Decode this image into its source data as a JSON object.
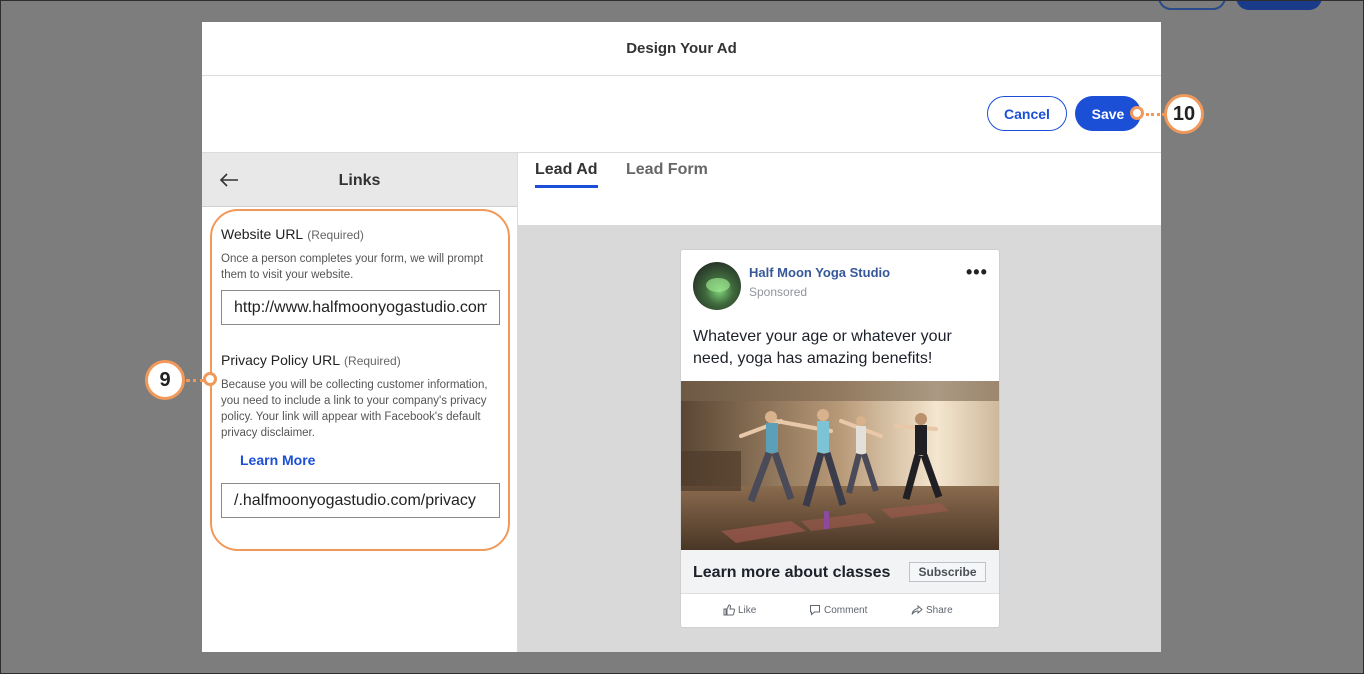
{
  "modal": {
    "title": "Design Your Ad",
    "cancel_label": "Cancel",
    "save_label": "Save"
  },
  "links_panel": {
    "back_icon": "back-arrow-icon",
    "title": "Links",
    "website": {
      "label": "Website URL",
      "required": "(Required)",
      "help": "Once a person completes your form, we will prompt them to visit your website.",
      "value": "http://www.halfmoonyogastudio.com"
    },
    "privacy": {
      "label": "Privacy Policy URL",
      "required": "(Required)",
      "help": "Because you will be collecting customer information, you need to include a link to your company's privacy policy. Your link will appear with Facebook's default privacy disclaimer.",
      "learn_more": "Learn More",
      "value": "/.halfmoonyogastudio.com/privacy"
    }
  },
  "tabs": [
    {
      "label": "Lead Ad",
      "active": true
    },
    {
      "label": "Lead Form",
      "active": false
    }
  ],
  "ad_preview": {
    "page_name": "Half Moon Yoga Studio",
    "sponsored": "Sponsored",
    "body_text": "Whatever your age or whatever your need, yoga has amazing benefits!",
    "cta_text": "Learn more about classes",
    "cta_button": "Subscribe",
    "actions": [
      {
        "label": "Like",
        "icon": "thumbs-up-icon"
      },
      {
        "label": "Comment",
        "icon": "comment-icon"
      },
      {
        "label": "Share",
        "icon": "share-icon"
      }
    ]
  },
  "callouts": {
    "step_9": "9",
    "step_10": "10"
  },
  "colors": {
    "accent": "#1a4fd6",
    "callout": "#f0995a",
    "fb_blue": "#365899"
  }
}
